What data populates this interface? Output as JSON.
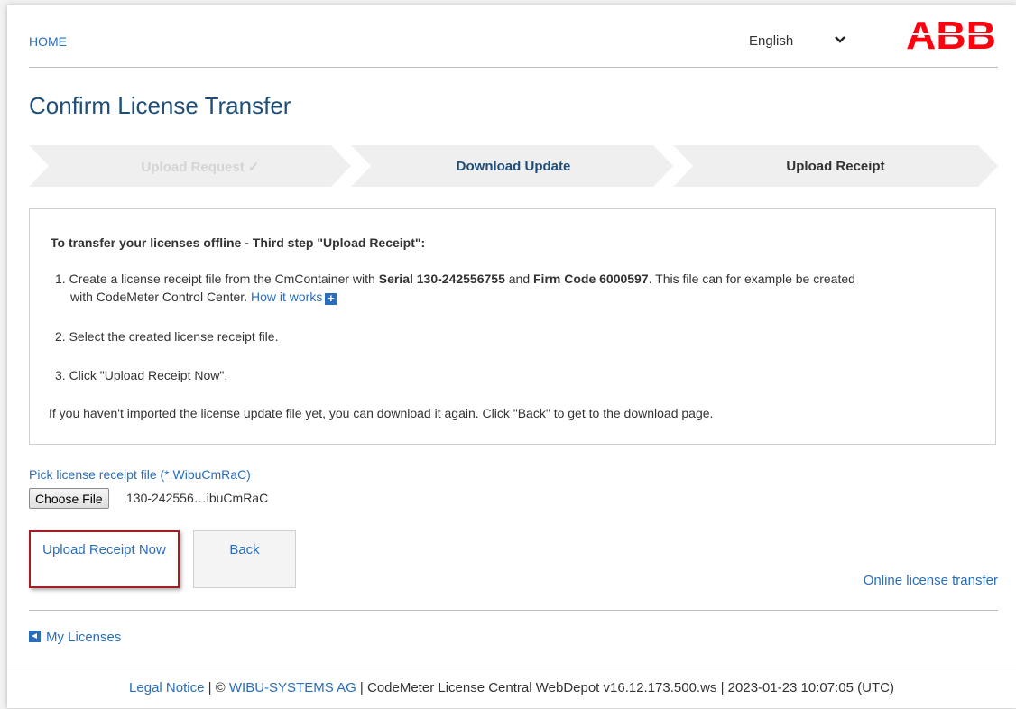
{
  "header": {
    "home_label": "HOME",
    "language": "English",
    "logo_text": "ABB",
    "logo_color": "#ff000f"
  },
  "page_title": "Confirm License Transfer",
  "steps": [
    {
      "label": "Upload Request ✓",
      "state": "completed"
    },
    {
      "label": "Download Update",
      "state": "previous"
    },
    {
      "label": "Upload Receipt",
      "state": "current"
    }
  ],
  "info": {
    "heading": "To transfer your licenses offline - Third step \"Upload Receipt\":",
    "item1": {
      "num": "1.",
      "text_a": "Create a license receipt file from the CmContainer with ",
      "serial": "Serial 130-242556755",
      "text_b": " and ",
      "firm_code": "Firm Code 6000597",
      "text_c": ". This file can for example be created",
      "text_d": "with CodeMeter Control Center. ",
      "how_link": "How it works",
      "plus": "+"
    },
    "item2": "2. Select the created license receipt file.",
    "item3": "3. Click \"Upload Receipt Now\".",
    "note": "If you haven't imported the license update file yet, you can download it again. Click \"Back\" to get to the download page."
  },
  "upload": {
    "pick_label": "Pick license receipt file (*.WibuCmRaC)",
    "choose_file": "Choose File",
    "file_name": "130-242556…ibuCmRaC"
  },
  "buttons": {
    "upload_now": "Upload Receipt Now",
    "back": "Back",
    "online_transfer": "Online license transfer"
  },
  "my_licenses": "My Licenses",
  "footer": {
    "legal": "Legal Notice",
    "sep1": " | © ",
    "wibu": "WIBU-SYSTEMS AG",
    "rest": " | CodeMeter License Central WebDepot v16.12.173.500.ws | 2023-01-23 10:07:05 (UTC)"
  },
  "colors": {
    "link": "#2a6ebb",
    "title": "#1f4e79",
    "highlight_border": "#a31d25"
  }
}
